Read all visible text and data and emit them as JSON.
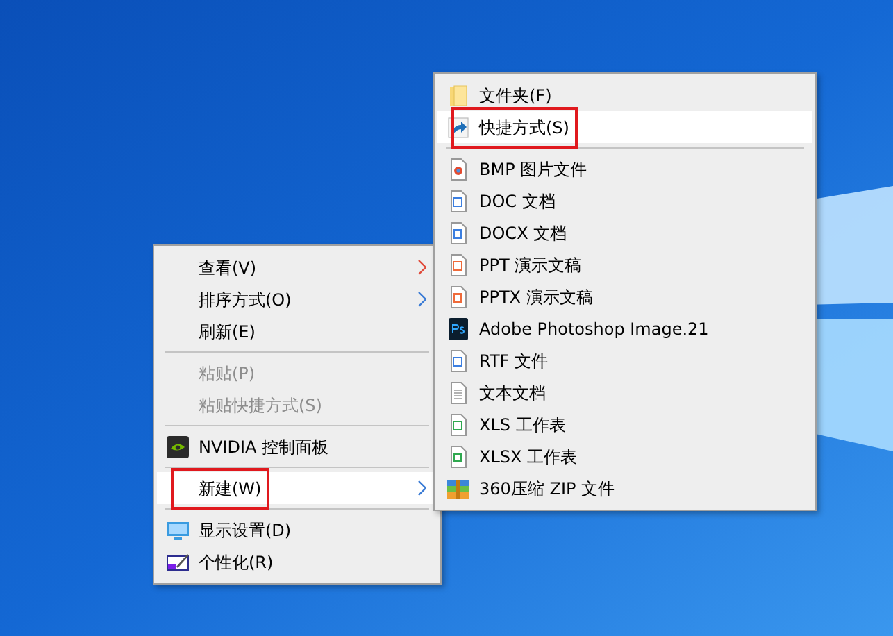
{
  "context_menu": {
    "items": [
      {
        "kind": "item",
        "label": "查看(V)",
        "submenu": true,
        "selected": false
      },
      {
        "kind": "item",
        "label": "排序方式(O)",
        "submenu": true,
        "selected": false
      },
      {
        "kind": "item",
        "label": "刷新(E)",
        "selected": false
      },
      {
        "kind": "separator"
      },
      {
        "kind": "item",
        "label": "粘贴(P)",
        "disabled": true,
        "selected": false
      },
      {
        "kind": "item",
        "label": "粘贴快捷方式(S)",
        "disabled": true,
        "selected": false
      },
      {
        "kind": "separator"
      },
      {
        "kind": "item",
        "label": "NVIDIA 控制面板",
        "selected": false
      },
      {
        "kind": "separator"
      },
      {
        "kind": "item",
        "label": "新建(W)",
        "submenu": true,
        "selected": true,
        "annotated": true
      },
      {
        "kind": "separator"
      },
      {
        "kind": "item",
        "label": "显示设置(D)",
        "selected": false
      },
      {
        "kind": "item",
        "label": "个性化(R)",
        "selected": false
      }
    ]
  },
  "new_submenu": {
    "items": [
      {
        "kind": "item",
        "label": "文件夹(F)",
        "selected": false
      },
      {
        "kind": "item",
        "label": "快捷方式(S)",
        "selected": true,
        "annotated": true
      },
      {
        "kind": "separator"
      },
      {
        "kind": "item",
        "label": "BMP 图片文件",
        "selected": false
      },
      {
        "kind": "item",
        "label": "DOC 文档",
        "selected": false
      },
      {
        "kind": "item",
        "label": "DOCX 文档",
        "selected": false
      },
      {
        "kind": "item",
        "label": "PPT 演示文稿",
        "selected": false
      },
      {
        "kind": "item",
        "label": "PPTX 演示文稿",
        "selected": false
      },
      {
        "kind": "item",
        "label": "Adobe Photoshop Image.21",
        "selected": false
      },
      {
        "kind": "item",
        "label": "RTF 文件",
        "selected": false
      },
      {
        "kind": "item",
        "label": "文本文档",
        "selected": false
      },
      {
        "kind": "item",
        "label": "XLS 工作表",
        "selected": false
      },
      {
        "kind": "item",
        "label": "XLSX 工作表",
        "selected": false
      },
      {
        "kind": "item",
        "label": "360压缩 ZIP 文件",
        "selected": false
      }
    ]
  }
}
